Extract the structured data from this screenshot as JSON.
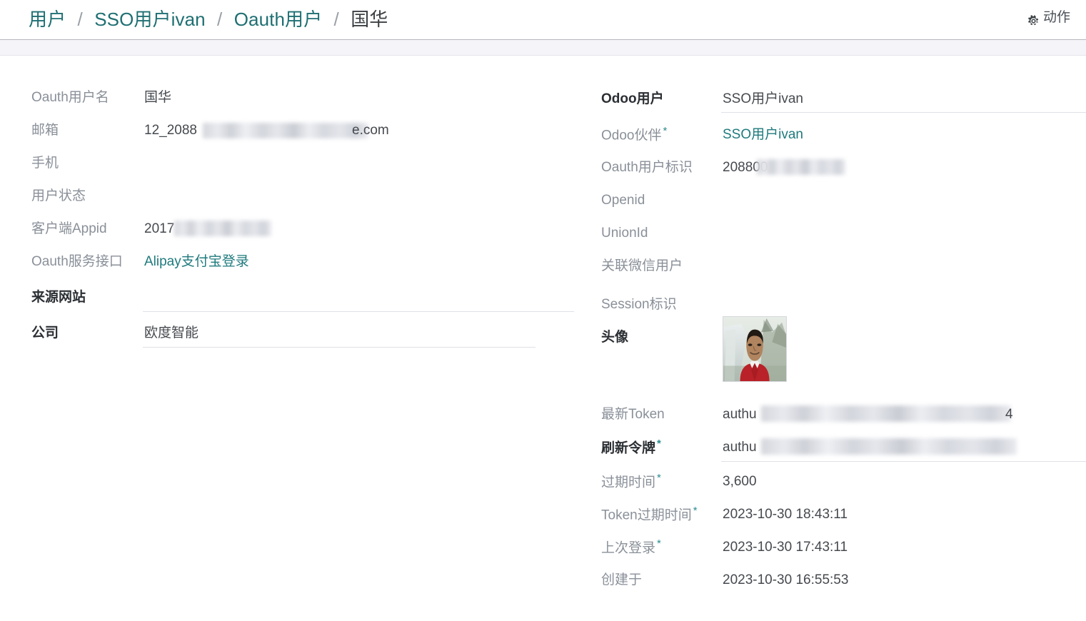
{
  "header": {
    "breadcrumb": [
      {
        "label": "用户",
        "current": false
      },
      {
        "label": "SSO用户ivan",
        "current": false
      },
      {
        "label": "Oauth用户",
        "current": false
      },
      {
        "label": "国华",
        "current": true
      }
    ],
    "separator": "/",
    "actions_label": "动作",
    "actions_icon": "gear-icon",
    "link_color": "#1f6f72"
  },
  "left_column": {
    "fields": [
      {
        "label": "Oauth用户名",
        "bold": false,
        "required": false,
        "value": "国华",
        "value_type": "text",
        "redacted": false
      },
      {
        "label": "邮箱",
        "bold": false,
        "required": false,
        "value": "12_2088",
        "value_type": "text",
        "redacted": true,
        "suffix": "e.com"
      },
      {
        "label": "手机",
        "bold": false,
        "required": false,
        "value": "",
        "value_type": "text",
        "redacted": false
      },
      {
        "label": "用户状态",
        "bold": false,
        "required": false,
        "value": "",
        "value_type": "text",
        "redacted": false
      },
      {
        "label": "客户端Appid",
        "bold": false,
        "required": false,
        "value": "2017",
        "value_type": "text",
        "redacted": true
      },
      {
        "label": "Oauth服务接口",
        "bold": false,
        "required": false,
        "value": "Alipay支付宝登录",
        "value_type": "link",
        "redacted": false
      },
      {
        "label": "来源网站",
        "bold": true,
        "required": false,
        "value": "",
        "value_type": "text",
        "redacted": false
      },
      {
        "label": "公司",
        "bold": true,
        "required": false,
        "value": "欧度智能",
        "value_type": "text",
        "redacted": false
      }
    ]
  },
  "right_column": {
    "fields": [
      {
        "label": "Odoo用户",
        "bold": true,
        "required": false,
        "value": "SSO用户ivan",
        "value_type": "text",
        "redacted": false
      },
      {
        "label": "Odoo伙伴",
        "bold": false,
        "required": true,
        "value": "SSO用户ivan",
        "value_type": "link",
        "redacted": false
      },
      {
        "label": "Oauth用户标识",
        "bold": false,
        "required": false,
        "value": "208800",
        "value_type": "text",
        "redacted": true
      },
      {
        "label": "Openid",
        "bold": false,
        "required": false,
        "value": "",
        "value_type": "text",
        "redacted": false
      },
      {
        "label": "UnionId",
        "bold": false,
        "required": false,
        "value": "",
        "value_type": "text",
        "redacted": false
      },
      {
        "label": "关联微信用户",
        "bold": false,
        "required": false,
        "value": "",
        "value_type": "text",
        "redacted": false
      },
      {
        "label": "Session标识",
        "bold": false,
        "required": false,
        "value": "",
        "value_type": "text",
        "redacted": false
      },
      {
        "label": "头像",
        "bold": true,
        "required": false,
        "value": "",
        "value_type": "image",
        "redacted": false
      },
      {
        "label": "最新Token",
        "bold": false,
        "required": false,
        "value": "authu",
        "value_type": "text",
        "redacted": true,
        "suffix": "4"
      },
      {
        "label": "刷新令牌",
        "bold": true,
        "required": true,
        "value": "authu",
        "value_type": "text",
        "redacted": true
      },
      {
        "label": "过期时间",
        "bold": false,
        "required": true,
        "value": "3,600",
        "value_type": "text",
        "redacted": false
      },
      {
        "label": "Token过期时间",
        "bold": false,
        "required": true,
        "value": "2023-10-30 18:43:11",
        "value_type": "text",
        "redacted": false
      },
      {
        "label": "上次登录",
        "bold": false,
        "required": true,
        "value": "2023-10-30 17:43:11",
        "value_type": "text",
        "redacted": false
      },
      {
        "label": "创建于",
        "bold": false,
        "required": false,
        "value": "2023-10-30 16:55:53",
        "value_type": "text",
        "redacted": false
      }
    ]
  }
}
